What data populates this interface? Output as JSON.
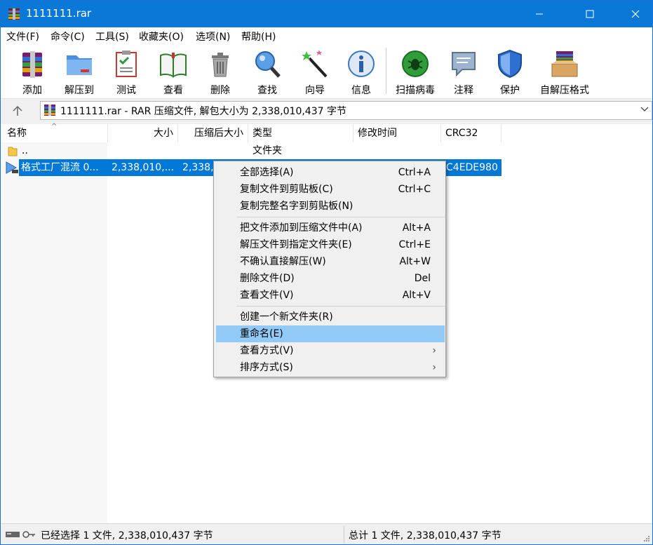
{
  "window": {
    "title": "1111111.rar"
  },
  "menubar": {
    "items": [
      "文件(F)",
      "命令(C)",
      "工具(S)",
      "收藏夹(O)",
      "选项(N)",
      "帮助(H)"
    ]
  },
  "toolbar": {
    "buttons": [
      {
        "label": "添加",
        "icon": "rar-archive-icon"
      },
      {
        "label": "解压到",
        "icon": "folder-extract-icon"
      },
      {
        "label": "测试",
        "icon": "checklist-icon"
      },
      {
        "label": "查看",
        "icon": "book-icon"
      },
      {
        "label": "删除",
        "icon": "trash-icon"
      },
      {
        "label": "查找",
        "icon": "magnifier-icon"
      },
      {
        "label": "向导",
        "icon": "magic-wand-icon"
      },
      {
        "label": "信息",
        "icon": "info-icon"
      },
      {
        "label": "扫描病毒",
        "icon": "virus-scan-icon"
      },
      {
        "label": "注释",
        "icon": "comment-icon"
      },
      {
        "label": "保护",
        "icon": "shield-icon"
      },
      {
        "label": "自解压格式",
        "icon": "sfx-box-icon"
      }
    ]
  },
  "address": {
    "text": "1111111.rar - RAR 压缩文件, 解包大小为 2,338,010,437 字节"
  },
  "columns": {
    "name": "名称",
    "size": "大小",
    "packed": "压缩后大小",
    "type": "类型",
    "modified": "修改时间",
    "crc": "CRC32"
  },
  "rows": [
    {
      "name": "..",
      "size": "",
      "packed": "",
      "type": "文件夹",
      "modified": "",
      "crc": ""
    },
    {
      "name": "格式工厂混流 0...",
      "size": "2,338,010,...",
      "packed": "2,338,",
      "type": "",
      "modified": "",
      "crc": "C4EDE980"
    }
  ],
  "context_menu": {
    "items": [
      {
        "label": "全部选择(A)",
        "shortcut": "Ctrl+A"
      },
      {
        "label": "复制文件到剪贴板(C)",
        "shortcut": "Ctrl+C"
      },
      {
        "label": "复制完整名字到剪贴板(N)",
        "shortcut": ""
      },
      {
        "label": "把文件添加到压缩文件中(A)",
        "shortcut": "Alt+A"
      },
      {
        "label": "解压文件到指定文件夹(E)",
        "shortcut": "Ctrl+E"
      },
      {
        "label": "不确认直接解压(W)",
        "shortcut": "Alt+W"
      },
      {
        "label": "删除文件(D)",
        "shortcut": "Del"
      },
      {
        "label": "查看文件(V)",
        "shortcut": "Alt+V"
      },
      {
        "label": "创建一个新文件夹(R)",
        "shortcut": ""
      },
      {
        "label": "重命名(E)",
        "shortcut": ""
      },
      {
        "label": "查看方式(V)",
        "shortcut": "›"
      },
      {
        "label": "排序方式(S)",
        "shortcut": "›"
      }
    ],
    "highlighted": "重命名(E)"
  },
  "status": {
    "left": "已经选择 1 文件, 2,338,010,437 字节",
    "right": "总计 1 文件, 2,338,010,437 字节"
  },
  "colors": {
    "titlebar": "#0a78d7",
    "selection": "#0078d7",
    "menu_hover": "#91c9f7"
  }
}
